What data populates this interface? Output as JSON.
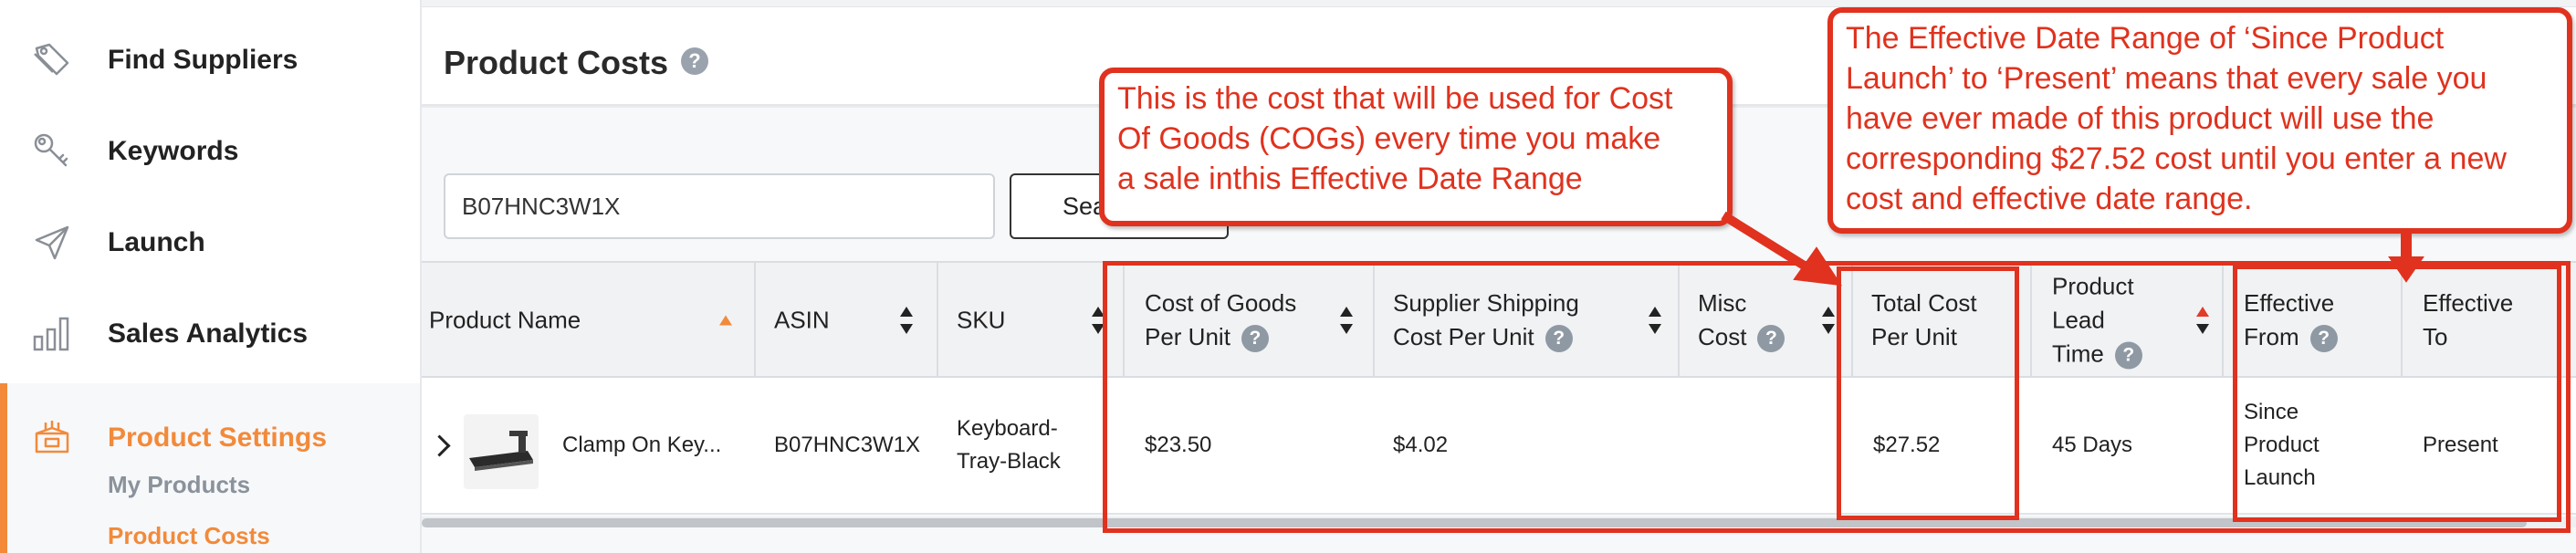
{
  "sidebar": {
    "items": [
      {
        "label": "Find Suppliers",
        "icon": "tag-icon"
      },
      {
        "label": "Keywords",
        "icon": "key-icon"
      },
      {
        "label": "Launch",
        "icon": "paper-plane-icon"
      },
      {
        "label": "Sales Analytics",
        "icon": "bar-chart-icon"
      },
      {
        "label": "Product Settings",
        "icon": "box-icon"
      }
    ],
    "sub_items": [
      "My Products",
      "Product Costs"
    ]
  },
  "page": {
    "title": "Product Costs",
    "help": "?"
  },
  "search": {
    "value": "B07HNC3W1X",
    "button_label": "Sea"
  },
  "table": {
    "headers": {
      "product_name": "Product Name",
      "asin": "ASIN",
      "sku": "SKU",
      "cogs_1": "Cost of Goods",
      "cogs_2": "Per Unit",
      "shipping_1": "Supplier Shipping",
      "shipping_2": "Cost Per Unit",
      "misc_1": "Misc",
      "misc_2": "Cost",
      "total_1": "Total Cost",
      "total_2": "Per Unit",
      "lead_1": "Product",
      "lead_2": "Lead",
      "lead_3": "Time",
      "from_1": "Effective",
      "from_2": "From",
      "to_1": "Effective",
      "to_2": "To"
    },
    "row": {
      "product_name": "Clamp On Key...",
      "asin": "B07HNC3W1X",
      "sku_1": "Keyboard-",
      "sku_2": "Tray-Black",
      "cogs": "$23.50",
      "shipping": "$4.02",
      "misc": "",
      "total": "$27.52",
      "lead_time": "45 Days",
      "from_1": "Since",
      "from_2": "Product",
      "from_3": "Launch",
      "to": "Present"
    }
  },
  "annotations": {
    "callout_cost": {
      "line1": "This is the cost that will be used for Cost",
      "line2": "Of Goods (COGs) every time you make",
      "line3": "a sale inthis Effective Date Range"
    },
    "callout_range": {
      "line1": "The Effective Date Range of ‘Since Product",
      "line2": "Launch’ to ‘Present’ means that every sale you",
      "line3": "have ever made of this product will use the",
      "line4": "corresponding $27.52 cost until you enter a new",
      "line5": "cost and effective date range."
    },
    "color": "#e0321e"
  },
  "colors": {
    "accent": "#f28a3a",
    "annotation": "#e0321e",
    "help_icon": "#8f99a4"
  }
}
